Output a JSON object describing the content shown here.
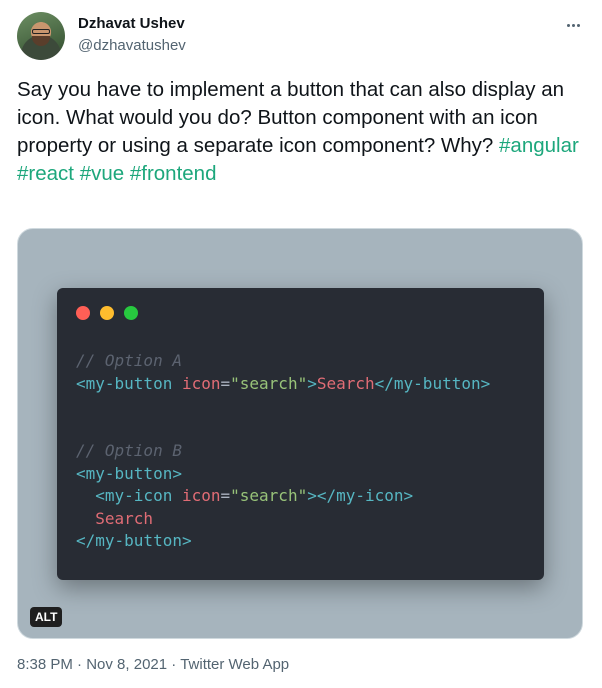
{
  "author": {
    "name": "Dzhavat Ushev",
    "handle": "@dzhavatushev"
  },
  "tweet": {
    "text": "Say you have to implement a button that can also display an icon. What would you do? Button component with an icon property or using a separate icon component? Why?",
    "hashtags": [
      "#angular",
      "#react",
      "#vue",
      "#frontend"
    ]
  },
  "code": {
    "comment_a": "// Option A",
    "line_a_tag_open": "<my-button",
    "line_a_attr": "icon",
    "line_a_eq": "=",
    "line_a_value": "\"search\"",
    "line_a_close_gt": ">",
    "line_a_text": "Search",
    "line_a_tag_close": "</my-button>",
    "comment_b": "// Option B",
    "line_b1": "<my-button>",
    "line_b2_tag_open": "<my-icon",
    "line_b2_attr": "icon",
    "line_b2_eq": "=",
    "line_b2_value": "\"search\"",
    "line_b2_close_gt": ">",
    "line_b2_tag_close": "</my-icon>",
    "line_b3": "Search",
    "line_b4": "</my-button>"
  },
  "media": {
    "alt_badge": "ALT"
  },
  "meta": {
    "time": "8:38 PM",
    "separator": "·",
    "date": "Nov 8, 2021",
    "source": "Twitter Web App"
  },
  "icons": {
    "more": "more-horizontal-icon"
  },
  "colors": {
    "hashtag": "#1da77c",
    "code_bg": "#282c34",
    "media_bg": "#a6b4bd"
  }
}
